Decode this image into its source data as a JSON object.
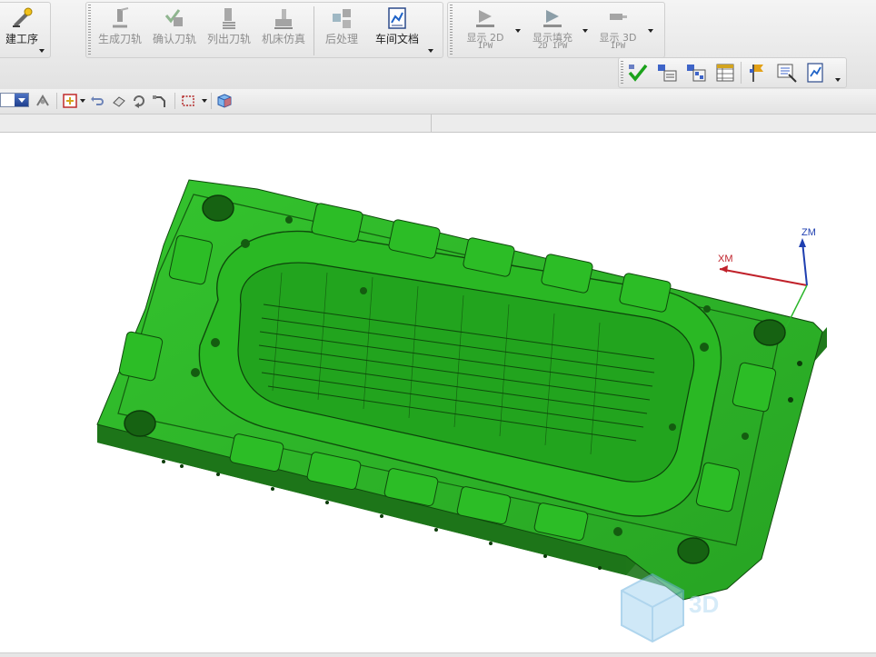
{
  "ribbon": {
    "create_operation": {
      "label": "建工序"
    },
    "generate_toolpath": {
      "label": "生成刀轨"
    },
    "verify_toolpath": {
      "label": "确认刀轨"
    },
    "list_toolpath": {
      "label": "列出刀轨"
    },
    "machine_simulate": {
      "label": "机床仿真"
    },
    "postprocess": {
      "label": "后处理"
    },
    "shop_docs": {
      "label": "车间文档"
    },
    "show_2d_ipw": {
      "label": "显示 2D",
      "sub": "IPW"
    },
    "show_fill_2d_ipw": {
      "label": "显示填充",
      "sub": "2D IPW"
    },
    "show_3d_ipw": {
      "label": "显示 3D",
      "sub": "IPW"
    }
  },
  "row2_icons": [
    "verify-check-icon",
    "operation-nav-icon",
    "tool-nav-icon",
    "feed-table-icon",
    "flag-icon",
    "view-select-icon",
    "report-icon"
  ],
  "toolbar": {
    "icons": [
      "render-mode-icon",
      "snap-point-icon",
      "undo-icon",
      "wcs-icon",
      "rotate-icon",
      "move-icon",
      "selection-box-icon",
      "cube-view-icon"
    ]
  },
  "viewport": {
    "axis_x_label": "XM",
    "axis_z_label": "ZM",
    "watermark_text": "3D",
    "colors": {
      "part_green": "#2fb52a",
      "part_dark": "#1e6b18",
      "axis_x": "#c0212a",
      "axis_z": "#1f3fb0"
    }
  }
}
